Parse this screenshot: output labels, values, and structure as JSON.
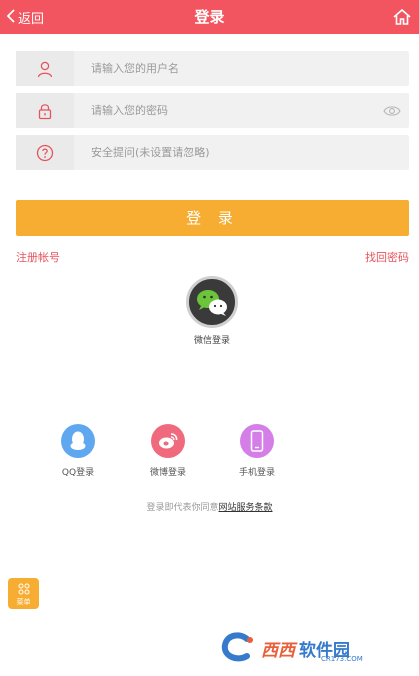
{
  "header": {
    "back_label": "返回",
    "title": "登录",
    "color": "#f2555f"
  },
  "form": {
    "username_placeholder": "请输入您的用户名",
    "password_placeholder": "请输入您的密码",
    "security_placeholder": "安全提问(未设置请忽略)",
    "login_label": "登 录",
    "login_color": "#f7ad32",
    "register_label": "注册帐号",
    "forgot_label": "找回密码"
  },
  "social": {
    "wechat_label": "微信登录",
    "qq_label": "QQ登录",
    "weibo_label": "微博登录",
    "phone_label": "手机登录"
  },
  "agreement": {
    "prefix": "登录即代表你同意",
    "terms": "网站服务条款"
  },
  "menu": {
    "label": "菜单"
  },
  "watermark": {
    "brand": "西西",
    "suffix": "软件园",
    "url": "CR173.COM"
  }
}
